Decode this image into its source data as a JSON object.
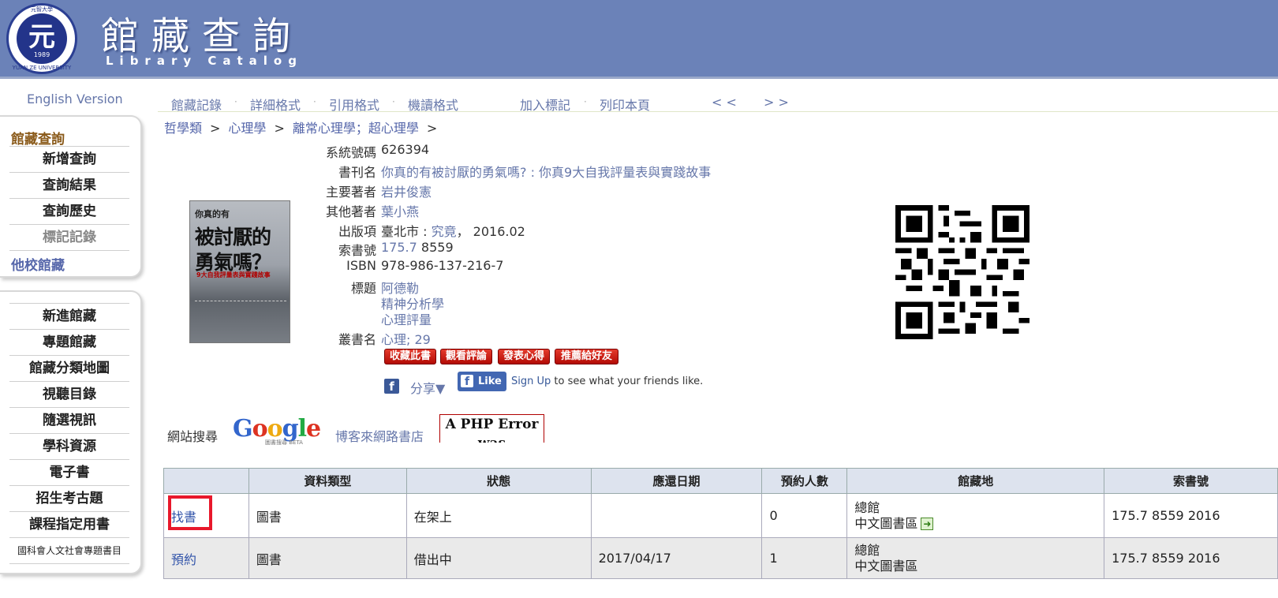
{
  "header": {
    "logo": {
      "ring_top": "元智大學",
      "ring_bottom": "YUAN ZE UNIVERSITY",
      "year": "1989",
      "mark": "元"
    },
    "title": "館藏查詢",
    "subtitle": "Library Catalog"
  },
  "sidebar": {
    "english_link": "English Version",
    "box1": {
      "heading": "館藏查詢",
      "items": [
        "新增查詢",
        "查詢結果",
        "查詢歷史",
        "標記記錄"
      ],
      "other_link": "他校館藏"
    },
    "box2": {
      "items": [
        "新進館藏",
        "專題館藏",
        "館藏分類地圖",
        "視聽目錄",
        "隨選視訊",
        "學科資源",
        "電子書",
        "招生考古題",
        "課程指定用書",
        "國科會人文社會專題書目"
      ]
    }
  },
  "toolbar": {
    "items": [
      "館藏記錄",
      "詳細格式",
      "引用格式",
      "機讀格式",
      "加入標記",
      "列印本頁",
      "< <",
      "> >"
    ]
  },
  "breadcrumb": [
    "哲學類",
    "心理學",
    "離常心理學；超心理學"
  ],
  "record": {
    "cover": {
      "line1": "你真的有",
      "line2": "被討厭的",
      "line3": "勇氣嗎？",
      "line4": "9大自我評量表與實踐故事"
    },
    "fields": {
      "system_no_label": "系統號碼",
      "system_no": "626394",
      "title_label": "書刊名",
      "title": "你真的有被討厭的勇氣嗎? : 你真9大自我評量表與實踐故事",
      "author_label": "主要著者",
      "author": "岩井俊憲",
      "other_author_label": "其他著者",
      "other_author": "葉小燕",
      "publisher_label": "出版項",
      "pub_place": "臺北市 : ",
      "pub_name": "究竟",
      "pub_date": "， 2016.02",
      "call_no_label": "索書號",
      "call_no_class": "175.7",
      "call_no_rest": " 8559",
      "isbn_label": "ISBN",
      "isbn": "978-986-137-216-7",
      "subject_label": "標題",
      "subjects": [
        "阿德勒",
        "精神分析學",
        "心理評量"
      ],
      "series_label": "叢書名",
      "series": "心理; 29"
    },
    "buttons": [
      "收藏此書",
      "觀看評論",
      "發表心得",
      "推薦給好友"
    ],
    "share_label": "分享▼",
    "like_label": "Like",
    "signup_link": "Sign Up",
    "signup_text": " to see what your friends like."
  },
  "websearch": {
    "label": "網站搜尋",
    "google_sub": "圖書搜尋 BETA",
    "blog_link": "博客來網路書店",
    "php_error": "A PHP Error was encountered"
  },
  "holdings": {
    "headers": [
      "",
      "資料類型",
      "狀態",
      "應還日期",
      "預約人數",
      "館藏地",
      "索書號"
    ],
    "rows": [
      {
        "action": "找書",
        "type": "圖書",
        "status": "在架上",
        "due": "",
        "holds": "0",
        "loc1": "總館",
        "loc2": "中文圖書區",
        "call": "175.7 8559 2016"
      },
      {
        "action": "預約",
        "type": "圖書",
        "status": "借出中",
        "due": "2017/04/17",
        "holds": "1",
        "loc1": "總館",
        "loc2": "中文圖書區",
        "call": "175.7 8559 2016"
      }
    ]
  }
}
